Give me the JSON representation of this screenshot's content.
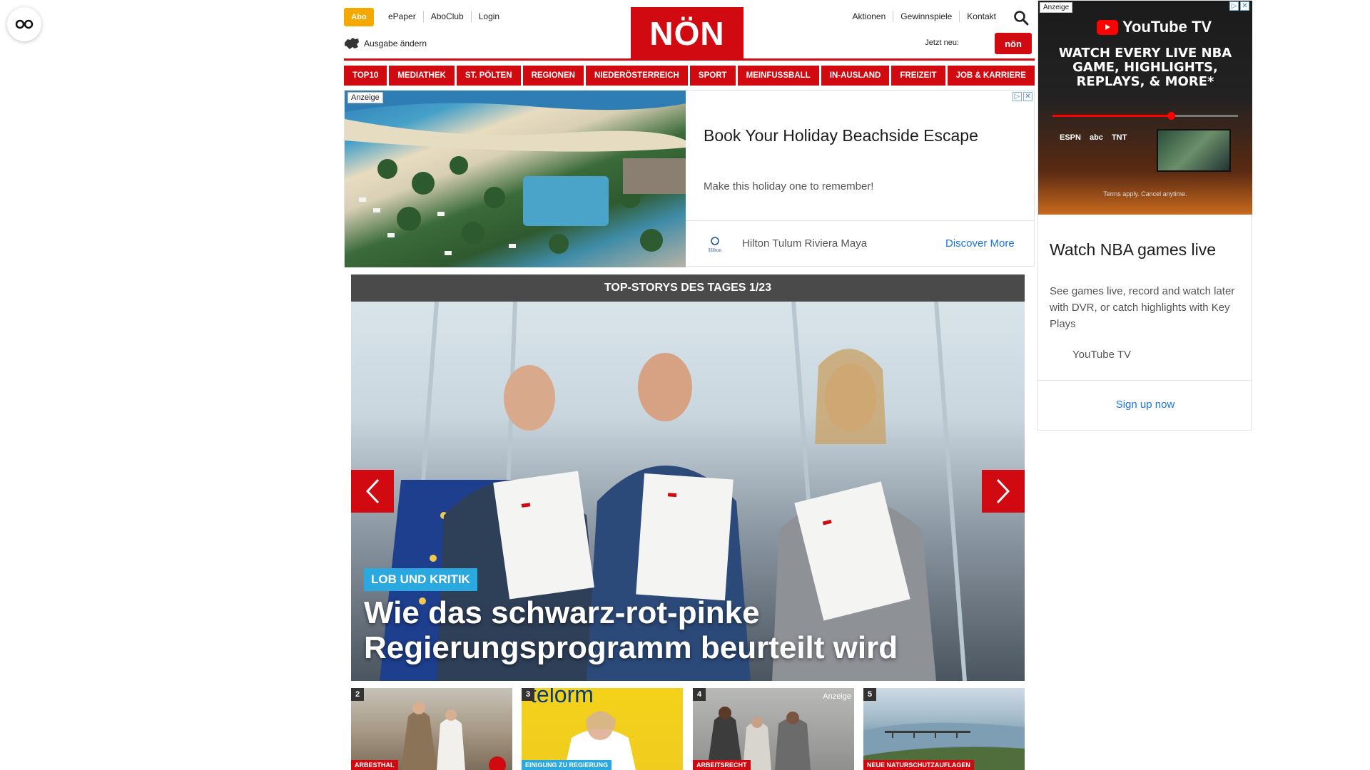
{
  "reader_button": {
    "icon": "glasses-icon"
  },
  "header": {
    "abo_label": "Abo",
    "top_left_links": [
      "ePaper",
      "AboClub",
      "Login"
    ],
    "edition_label": "Ausgabe ändern",
    "logo_text": "NÖN",
    "top_right_links": [
      "Aktionen",
      "Gewinnspiele",
      "Kontakt"
    ],
    "jetzt_neu_label": "Jetzt neu:",
    "jetzt_badge": "nön",
    "search_icon": "search-icon"
  },
  "nav": {
    "items": [
      "TOP10",
      "MEDIATHEK",
      "ST. PÖLTEN",
      "REGIONEN",
      "NIEDERÖSTERREICH",
      "SPORT",
      "MEINFUSSBALL",
      "IN-AUSLAND",
      "FREIZEIT",
      "JOB & KARRIERE"
    ]
  },
  "top_ad": {
    "anzeige": "Anzeige",
    "title": "Book Your Holiday Beachside Escape",
    "description": "Make this holiday one to remember!",
    "brand": "Hilton Tulum Riviera Maya",
    "brand_icon_text": "Hilton",
    "cta": "Discover More"
  },
  "right_ad": {
    "anzeige": "Anzeige",
    "logo_text": "YouTube TV",
    "headline": "WATCH EVERY LIVE NBA GAME, HIGHLIGHTS, REPLAYS, & MORE*",
    "progress_fraction": 0.64,
    "channels": [
      "ESPN",
      "abc",
      "TNT"
    ],
    "terms": "Terms apply. Cancel anytime.",
    "title": "Watch NBA games live",
    "description": "See games live, record and watch later with DVR, or catch highlights with Key Plays",
    "brand": "YouTube TV",
    "cta": "Sign up now"
  },
  "top_stories": {
    "header": "TOP-STORYS DES TAGES 1/23",
    "slide": {
      "kicker": "LOB UND KRITIK",
      "title": "Wie das schwarz-rot-pinke Regierungsprogramm beurteilt wird"
    },
    "thumbnails": [
      {
        "number": "2",
        "tag": "ARBESTHAL",
        "tag_color": "#d10a11",
        "anzeige": ""
      },
      {
        "number": "3",
        "tag": "EINIGUNG ZU REGIERUNG",
        "tag_color": "#2aa8e0",
        "anzeige": ""
      },
      {
        "number": "4",
        "tag": "ARBEITSRECHT",
        "tag_color": "#d10a11",
        "anzeige": "Anzeige"
      },
      {
        "number": "5",
        "tag": "NEUE NATURSCHUTZAUFLAGEN",
        "tag_color": "#d10a11",
        "anzeige": ""
      }
    ]
  },
  "colors": {
    "brand_red": "#d10a11",
    "abo_orange": "#f5a800",
    "kicker_blue": "#2aa8e0",
    "link_blue": "#1a73e8"
  }
}
